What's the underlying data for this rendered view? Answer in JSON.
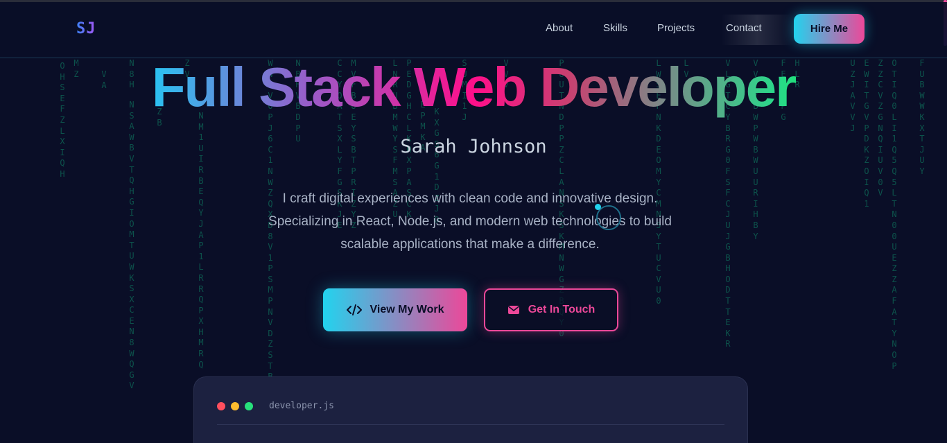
{
  "nav": {
    "logo": "SJ",
    "links": [
      "About",
      "Skills",
      "Projects",
      "Contact"
    ],
    "hire_label": "Hire Me"
  },
  "hero": {
    "title": "Full Stack Web Developer",
    "name": "Sarah Johnson",
    "description": "I craft digital experiences with clean code and innovative design. Specializing in React, Node.js, and modern web technologies to build scalable applications that make a difference.",
    "primary_button": "View My Work",
    "secondary_button": "Get In Touch"
  },
  "code_window": {
    "filename": "developer.js"
  },
  "colors": {
    "background": "#0a0e27",
    "accent_cyan": "#22d3ee",
    "accent_pink": "#ec4899",
    "matrix_green": "#10b981"
  },
  "icons": {
    "primary_button": "code-icon",
    "secondary_button": "envelope-icon"
  },
  "matrix_columns": [
    "OHSEFZLXIQH",
    "MZ",
    "VA",
    "N8H",
    "NSAWBVTQHGIOMTUWKSXCEN8WQGV",
    "ZB",
    "ZV",
    "NM1UIRBEQYJAP1LRRQPXHMRQ",
    "NBHVBDPU",
    "WWAV0PJ6C1NWZQXD8V1PSMPNVDZSTB",
    "CCYOATSXLYFGSKJE",
    "MVFBUEYSBTPRIZYZ",
    "LNRUBMWYSFMSAZU",
    "PEDGHCLKHXPASCK",
    "EPMKA",
    "KXGS6G1DZJO",
    "SUMI1J",
    "VVV",
    "PUUTNDPPZCLANSKSKMNWGZBQY0",
    "LWSEFNKDEOMYCMN5YTUCVU0",
    "LVJ",
    "VLGTCYBRG0FSFCJUJGBHODTTEKR",
    "VVVYBWPWBWUURIHBY",
    "FECPPG",
    "HLR",
    "UZJAVVJ",
    "EWITGVPDKZOIQ1",
    "ZZCVZGNQIUV0V",
    "OTIQ0LI1Q5Q5LTN00UEZZAFATYNOP",
    "FUBWWKXTJUY"
  ]
}
